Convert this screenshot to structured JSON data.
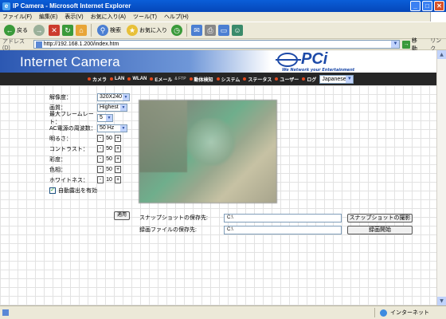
{
  "window": {
    "title": "IP Camera - Microsoft Internet Explorer",
    "buttons": {
      "min": "_",
      "max": "□",
      "close": "✕"
    }
  },
  "menu": [
    "ファイル(F)",
    "編集(E)",
    "表示(V)",
    "お気に入り(A)",
    "ツール(T)",
    "ヘルプ(H)"
  ],
  "toolbar": {
    "back": "戻る",
    "search": "検索",
    "favorites": "お気に入り"
  },
  "address": {
    "label": "アドレス(D)",
    "url": "http://192.168.1.200/index.htm",
    "go": "移動",
    "links": "リンク"
  },
  "header": {
    "brand": "Internet Camera",
    "logo_text": "PCi",
    "logo_tagline": "We Network your Entertainment"
  },
  "nav": {
    "items": [
      {
        "label": "カメラ"
      },
      {
        "label": "LAN"
      },
      {
        "label": "WLAN"
      },
      {
        "label": "Eメール",
        "sub": "& FTP"
      },
      {
        "label": "動体検知"
      },
      {
        "label": "システム"
      },
      {
        "label": "ステータス"
      },
      {
        "label": "ユーザー"
      },
      {
        "label": "ログ"
      }
    ],
    "language": "Japanese"
  },
  "settings": {
    "resolution": {
      "label": "解像度：",
      "value": "320X240"
    },
    "quality": {
      "label": "画質：",
      "value": "Highest"
    },
    "max_frame_rate": {
      "label": "最大フレームレート：",
      "value": "5"
    },
    "ac_frequency": {
      "label": "AC電源の周波数：",
      "value": "50 Hz"
    },
    "brightness": {
      "label": "明るさ：",
      "value": "50"
    },
    "contrast": {
      "label": "コントラスト：",
      "value": "50"
    },
    "saturation": {
      "label": "彩度：",
      "value": "50"
    },
    "hue": {
      "label": "色相：",
      "value": "50"
    },
    "whiteness": {
      "label": "ホワイトネス：",
      "value": "10"
    },
    "auto_exposure": {
      "label": "自動露出を有効",
      "checked": true
    },
    "apply_label": "適用",
    "minus": "-",
    "plus": "+"
  },
  "files": {
    "snapshot_label": "スナップショットの保存先:",
    "snapshot_path": "C:\\",
    "snapshot_button": "スナップショットの撮影",
    "record_label": "録画ファイルの保存先:",
    "record_path": "C:\\",
    "record_button": "録画開始"
  },
  "status": {
    "zone": "インターネット"
  },
  "colors": {
    "titlebar": "#0a5ed8",
    "nav_bg": "#262626",
    "nav_dot": "#e24a1f",
    "brand_band": "#2c58b2"
  }
}
